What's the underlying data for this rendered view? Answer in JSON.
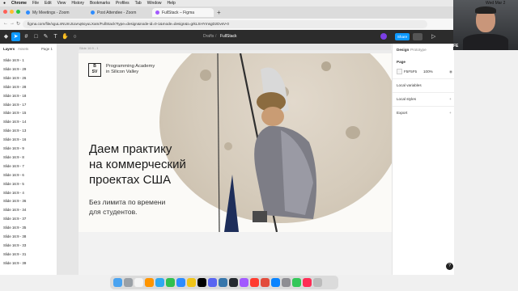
{
  "menubar": {
    "items": [
      "Chrome",
      "File",
      "Edit",
      "View",
      "History",
      "Bookmarks",
      "Profiles",
      "Tab",
      "Window",
      "Help"
    ],
    "clock": "Wed Mar 2"
  },
  "browser": {
    "tabs": [
      {
        "title": "My Meetings - Zoom",
        "color": "#2d8cff"
      },
      {
        "title": "Post Attendee - Zoom",
        "color": "#2d8cff"
      },
      {
        "title": "FullStack – Figma",
        "color": "#a259ff"
      }
    ],
    "url": "figma.com/file/xguLnNUmJUaAq6oyuLXam/FullStack?type=design&node-id=0-1&mode=design&t=grkLSHYmsgDzDvsV-0"
  },
  "figma": {
    "breadcrumb_project": "Drafts",
    "breadcrumb_file": "FullStack",
    "share_label": "Share",
    "left_tabs": [
      "Layers",
      "Assets"
    ],
    "page_label": "Page 1",
    "layers": [
      "Slide 16:9 - 1",
      "Slide 16:9 - 29",
      "Slide 16:9 - 26",
      "Slide 16:9 - 28",
      "Slide 16:9 - 18",
      "Slide 16:9 - 17",
      "Slide 16:9 - 15",
      "Slide 16:9 - 14",
      "Slide 16:9 - 13",
      "Slide 16:9 - 16",
      "Slide 16:9 - 9",
      "Slide 16:9 - 8",
      "Slide 16:9 - 7",
      "Slide 16:9 - 6",
      "Slide 16:9 - 5",
      "Slide 16:9 - 4",
      "Slide 16:9 - 36",
      "Slide 16:9 - 34",
      "Slide 16:9 - 37",
      "Slide 16:9 - 35",
      "Slide 16:9 - 38",
      "Slide 16:9 - 33",
      "Slide 16:9 - 31",
      "Slide 16:9 - 39"
    ],
    "frame_label": "Slide 16:9 - 1",
    "right_tabs": [
      "Design",
      "Prototype"
    ],
    "page_section": "Page",
    "bg_hex": "F5F5F5",
    "bg_opacity": "100%",
    "local_variables": "Local variables",
    "local_styles": "Local styles",
    "export": "Export",
    "help": "?"
  },
  "slide": {
    "logo_line1": "Programming Academy",
    "logo_line2": "in Silicon Valley",
    "headline": [
      "Даем практику",
      "на коммерческий",
      "проектах США"
    ],
    "subtext": [
      "Без лимита по времени",
      "для студентов."
    ]
  },
  "webcam_label": "FE"
}
